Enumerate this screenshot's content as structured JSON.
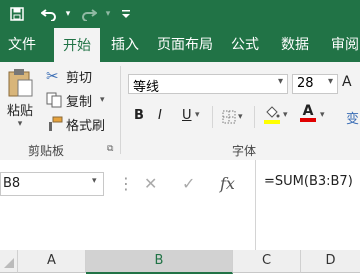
{
  "qat": {
    "save_icon": "save-icon",
    "undo_icon": "undo-icon",
    "redo_icon": "redo-icon",
    "customize_icon": "chevron-down-icon"
  },
  "tabs": [
    {
      "label": "文件"
    },
    {
      "label": "开始",
      "active": true
    },
    {
      "label": "插入"
    },
    {
      "label": "页面布局"
    },
    {
      "label": "公式"
    },
    {
      "label": "数据"
    },
    {
      "label": "审阅"
    }
  ],
  "clipboard": {
    "paste_label": "粘贴",
    "cut_label": "剪切",
    "copy_label": "复制",
    "format_painter_label": "格式刷",
    "group_label": "剪贴板"
  },
  "font": {
    "font_name": "等线",
    "font_size": "28",
    "bold": "B",
    "italic": "I",
    "underline": "U",
    "font_color_glyph": "A",
    "group_label": "字体",
    "extra_glyph": "变"
  },
  "formula_bar": {
    "name_box": "B8",
    "cancel_glyph": "✕",
    "enter_glyph": "✓",
    "fx_glyph": "fx",
    "formula": "=SUM(B3:B7)"
  },
  "columns": [
    "A",
    "B",
    "C",
    "D"
  ],
  "colors": {
    "accent": "#217346",
    "highlight_yellow": "#ffff00",
    "font_red": "#e00000"
  }
}
